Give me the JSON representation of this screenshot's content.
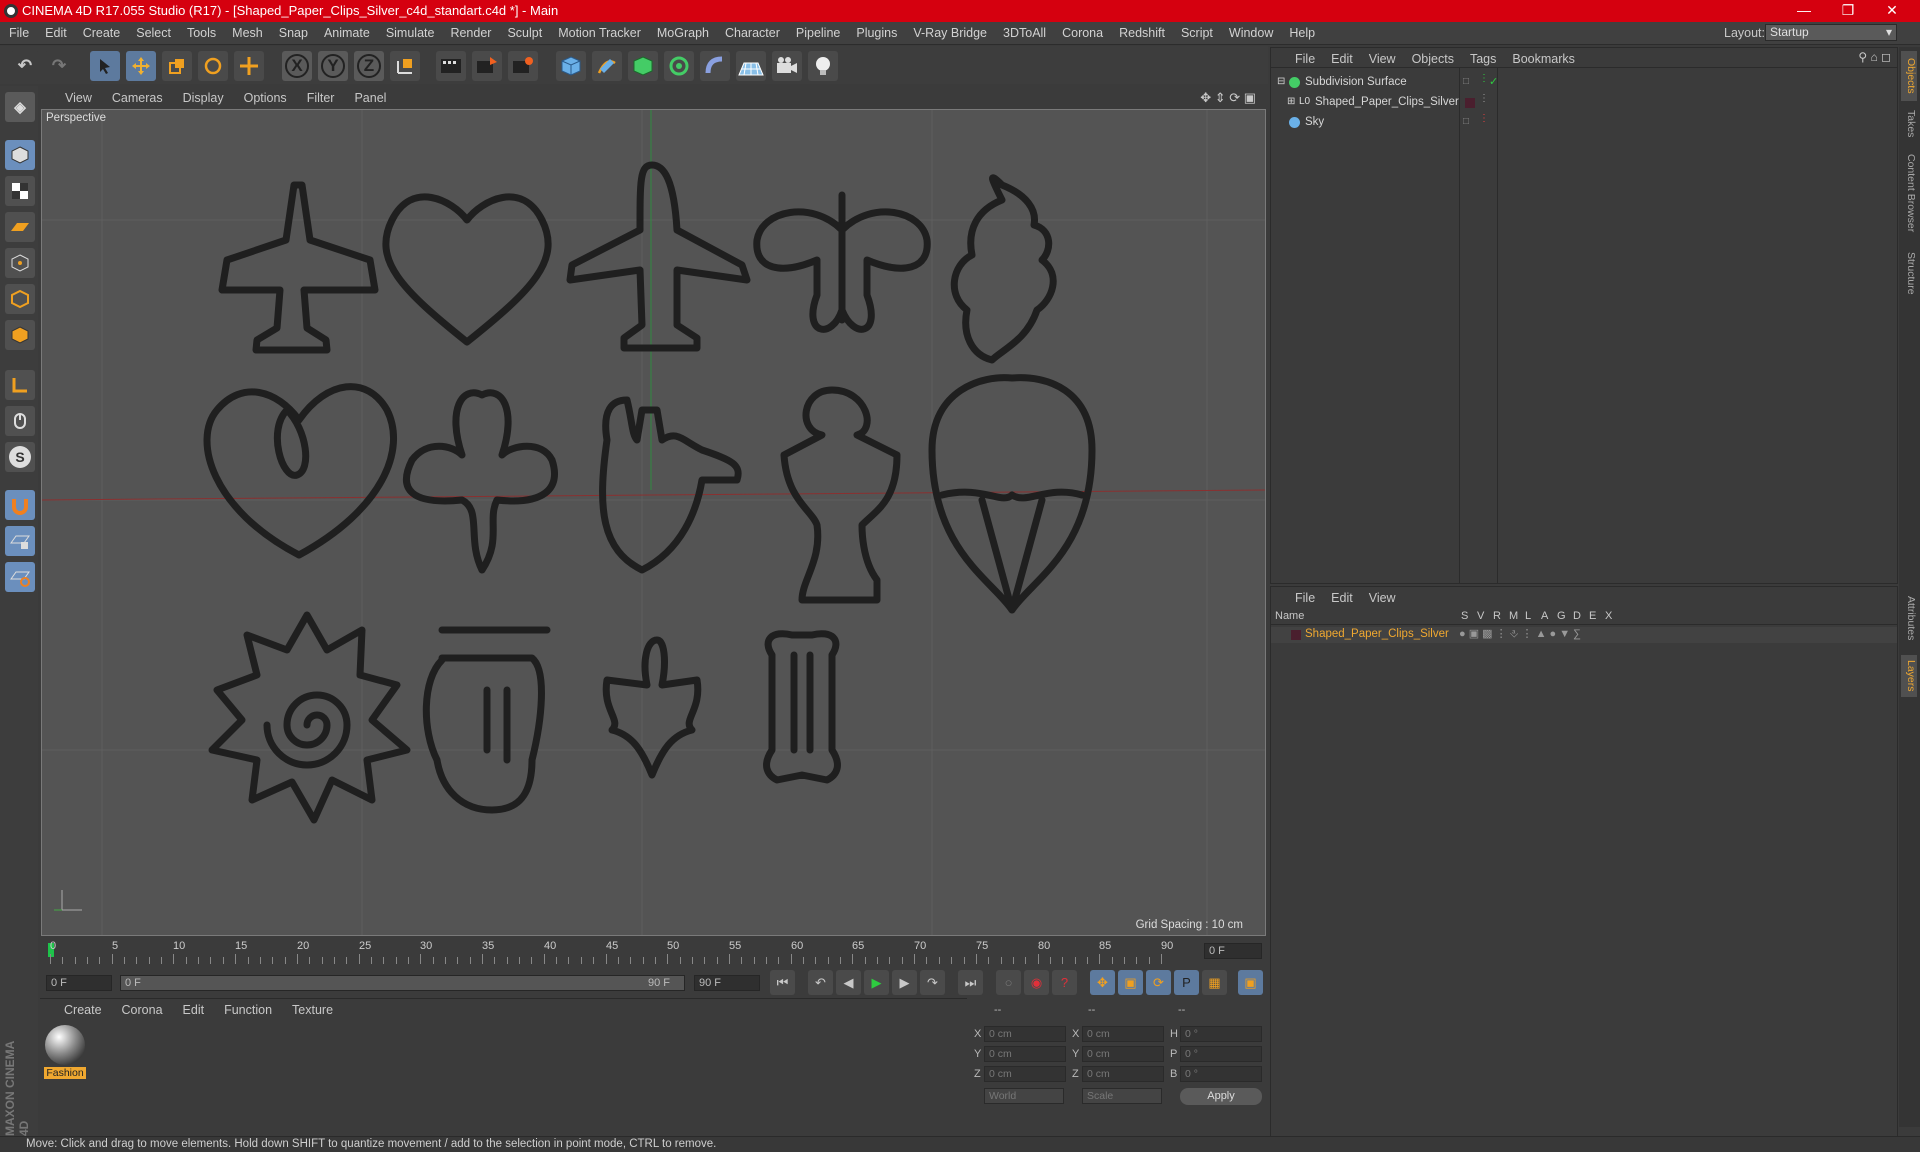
{
  "window": {
    "title": "CINEMA 4D R17.055 Studio (R17) - [Shaped_Paper_Clips_Silver_c4d_standart.c4d *] - Main"
  },
  "menubar": {
    "items": [
      "File",
      "Edit",
      "Create",
      "Select",
      "Tools",
      "Mesh",
      "Snap",
      "Animate",
      "Simulate",
      "Render",
      "Sculpt",
      "Motion Tracker",
      "MoGraph",
      "Character",
      "Pipeline",
      "Plugins",
      "V-Ray Bridge",
      "3DToAll",
      "Corona",
      "Redshift",
      "Script",
      "Window",
      "Help"
    ],
    "layout_label": "Layout:",
    "layout_value": "Startup"
  },
  "toolbar": {
    "axes": [
      "X",
      "Y",
      "Z"
    ]
  },
  "viewport": {
    "menu": [
      "View",
      "Cameras",
      "Display",
      "Options",
      "Filter",
      "Panel"
    ],
    "camera_label": "Perspective",
    "grid_spacing": "Grid Spacing : 10 cm"
  },
  "timeline": {
    "ticks": [
      "0",
      "5",
      "10",
      "15",
      "20",
      "25",
      "30",
      "35",
      "40",
      "45",
      "50",
      "55",
      "60",
      "65",
      "70",
      "75",
      "80",
      "85",
      "90"
    ],
    "end_field": "0 F",
    "start_frame": "0 F",
    "range_start": "0 F",
    "range_end": "90 F",
    "max_frame": "90 F"
  },
  "material_manager": {
    "menu": [
      "Create",
      "Corona",
      "Edit",
      "Function",
      "Texture"
    ],
    "material_name": "Fashion"
  },
  "coordinates": {
    "headers": [
      "--",
      "--",
      "--"
    ],
    "rows": [
      {
        "a": "X",
        "v1": "0 cm",
        "b": "X",
        "v2": "0 cm",
        "c": "H",
        "v3": "0 °"
      },
      {
        "a": "Y",
        "v1": "0 cm",
        "b": "Y",
        "v2": "0 cm",
        "c": "P",
        "v3": "0 °"
      },
      {
        "a": "Z",
        "v1": "0 cm",
        "b": "Z",
        "v2": "0 cm",
        "c": "B",
        "v3": "0 °"
      }
    ],
    "world": "World",
    "scale": "Scale",
    "apply": "Apply"
  },
  "object_manager": {
    "menu": [
      "File",
      "Edit",
      "View",
      "Objects",
      "Tags",
      "Bookmarks"
    ],
    "objects": [
      "Subdivision Surface",
      "Shaped_Paper_Clips_Silver",
      "Sky"
    ]
  },
  "layer_manager": {
    "menu": [
      "File",
      "Edit",
      "View"
    ],
    "columns": [
      "Name",
      "S",
      "V",
      "R",
      "M",
      "L",
      "A",
      "G",
      "D",
      "E",
      "X"
    ],
    "layer_name": "Shaped_Paper_Clips_Silver"
  },
  "right_tabs": [
    "Objects",
    "Takes",
    "Content Browser",
    "Structure",
    "Attributes",
    "Layers"
  ],
  "status": "Move: Click and drag to move elements. Hold down SHIFT to quantize movement / add to the selection in point mode, CTRL to remove.",
  "branding": "MAXON CINEMA 4D",
  "colors": {
    "titlebar": "#d5000f",
    "accent": "#5d7a9e",
    "layer_color": "#4a1f2e",
    "highlight": "#f0a830"
  }
}
